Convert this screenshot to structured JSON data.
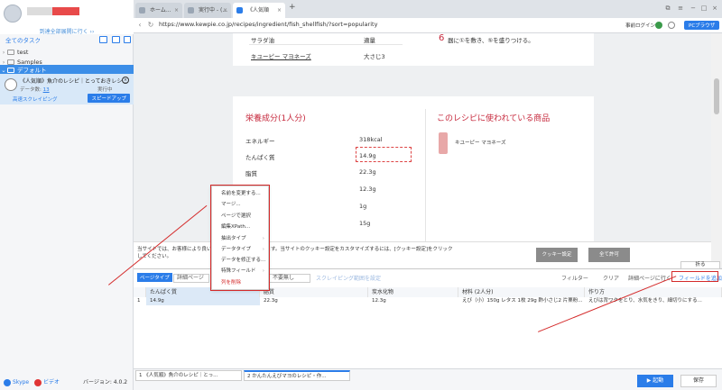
{
  "sidebar": {
    "header_link": "到達全部展開に行く ››",
    "all_tasks": "全てのタスク",
    "folders": [
      "test",
      "Samples"
    ],
    "default_group": "デフォルト",
    "task": {
      "title": "《人気順》魚介のレシピ｜とっておきレシ...",
      "data_count_label": "データ数:",
      "data_count": "13",
      "state": "実行中",
      "mode": "高速スクレイピング",
      "speed_button": "スピードアップ"
    },
    "footer": {
      "skype": "Skype",
      "video": "ビデオ",
      "version": "バージョン: 4.0.2"
    }
  },
  "browser": {
    "tabs": [
      {
        "label": "ホーム..."
      },
      {
        "label": "実行中 - (..."
      },
      {
        "label": "《人気順"
      }
    ],
    "new_tab": "+",
    "url": "https://www.kewpie.co.jp/recipes/ingredient/fish_shellfish/?sort=popularity",
    "login_label": "事前ログイン",
    "pc_browser": "PCブラウザ"
  },
  "page": {
    "ingredients": [
      {
        "name": "サラダ油",
        "amount": "適量"
      },
      {
        "name": "キユーピー マヨネーズ",
        "amount": "大さじ3"
      }
    ],
    "step_number": "6",
    "step_text": "器に①を敷き、⑤を盛りつける。",
    "nutrition_title": "栄養成分(1人分)",
    "nutrition": [
      {
        "label": "エネルギー",
        "value": "318kcal"
      },
      {
        "label": "たんぱく質",
        "value": "14.9g"
      },
      {
        "label": "脂質",
        "value": "22.3g"
      },
      {
        "label": "炭",
        "value": "12.3g"
      },
      {
        "label": "食",
        "value": "1g"
      },
      {
        "label": "",
        "value": "15g"
      }
    ],
    "products_title": "このレシピに使われている商品",
    "product_name": "キユーピー マヨネーズ"
  },
  "cookie": {
    "text": "当サイトでは、お客様により良い...クッキーを利用しています。当サイトのクッキー設定をカスタマイズするには、[クッキー設定]をクリックしてください。",
    "settings_button": "クッキー設定",
    "accept_button": "全て許可"
  },
  "panel": {
    "collapse": "折る",
    "page_type": "ページタイプ",
    "page_type_value": "詳細ページ",
    "pagination_value": "不要無し",
    "scrape_range": "スクレイピング範囲を設定",
    "filter": "フィルター",
    "clear": "クリア",
    "detail_collect": "詳細ページに行く",
    "add_field": "フィールドを追加",
    "columns": [
      "たんぱく質",
      "脂質",
      "炭水化物",
      "材料 (2人分)",
      "作り方"
    ],
    "row": {
      "index": "1",
      "values": [
        "14.9g",
        "22.3g",
        "12.3g",
        "えび（小）150g レタス 1枚 29g 酢小さじ2 片栗粉...",
        "えびは背ワタをとり、水気をきり、細切りにする..."
      ]
    }
  },
  "context_menu": {
    "items": [
      {
        "label": "名前を変更する..."
      },
      {
        "label": "マージ..."
      },
      {
        "label": "ページで選択"
      },
      {
        "label": "編集XPath..."
      },
      {
        "label": "抽出タイプ",
        "submenu": true
      },
      {
        "label": "データタイプ",
        "submenu": true
      },
      {
        "label": "データを修正する...",
        "submenu": false
      },
      {
        "label": "特殊フィールド",
        "submenu": true
      },
      {
        "label": "列を削除",
        "danger": true
      }
    ]
  },
  "bottom_tabs": [
    "1 《人気順》魚介のレシピ｜とっ...",
    "2 かんたんえびマヨのレシピ・作..."
  ],
  "actions": {
    "start": "▶ 起動",
    "save": "保存"
  },
  "colors": {
    "accent": "#2b7de9",
    "red": "#c6283c",
    "annotation": "#d42a2a"
  }
}
